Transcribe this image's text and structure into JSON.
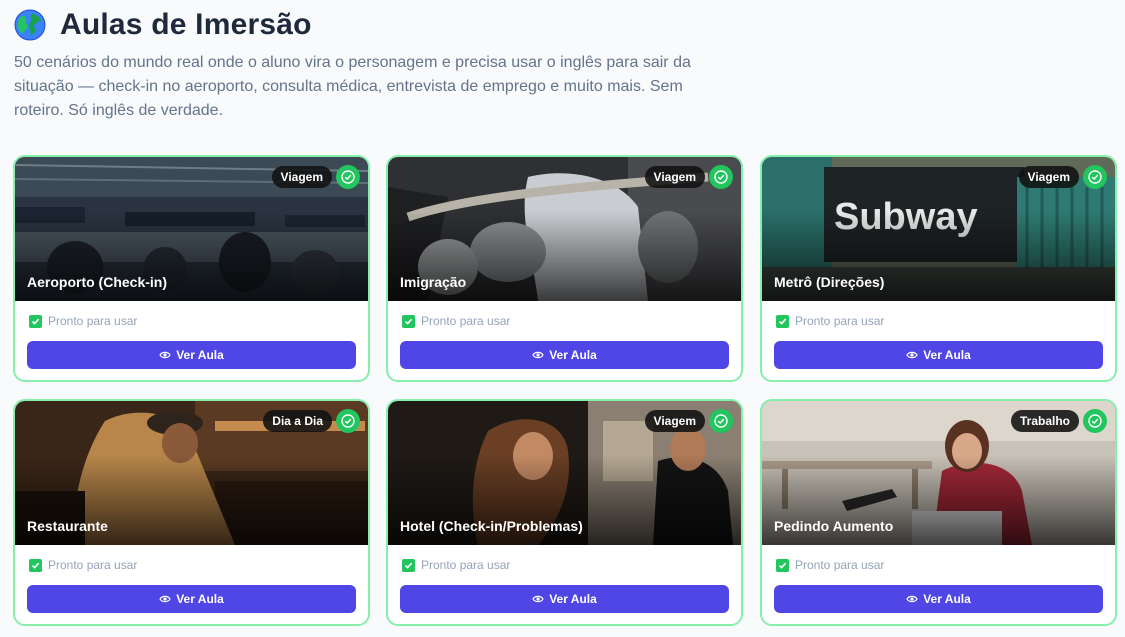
{
  "header": {
    "icon": "globe-icon",
    "title": "Aulas de Imersão",
    "subtitle": "50 cenários do mundo real onde o aluno vira o personagem e precisa usar o inglês para sair da situação — check-in no aeroporto, consulta médica, entrevista de emprego e muito mais. Sem roteiro. Só inglês de verdade."
  },
  "colors": {
    "accent": "#4f46e5",
    "success": "#22c55e",
    "card_border": "#86efac"
  },
  "cards": [
    {
      "title": "Aeroporto (Check-in)",
      "tag": "Viagem",
      "status": "Pronto para usar",
      "button": "Ver Aula"
    },
    {
      "title": "Imigração",
      "tag": "Viagem",
      "status": "Pronto para usar",
      "button": "Ver Aula"
    },
    {
      "title": "Metrô (Direções)",
      "tag": "Viagem",
      "status": "Pronto para usar",
      "button": "Ver Aula",
      "photo_text": "Subway"
    },
    {
      "title": "Restaurante",
      "tag": "Dia a Dia",
      "status": "Pronto para usar",
      "button": "Ver Aula"
    },
    {
      "title": "Hotel (Check-in/Problemas)",
      "tag": "Viagem",
      "status": "Pronto para usar",
      "button": "Ver Aula"
    },
    {
      "title": "Pedindo Aumento",
      "tag": "Trabalho",
      "status": "Pronto para usar",
      "button": "Ver Aula"
    }
  ]
}
